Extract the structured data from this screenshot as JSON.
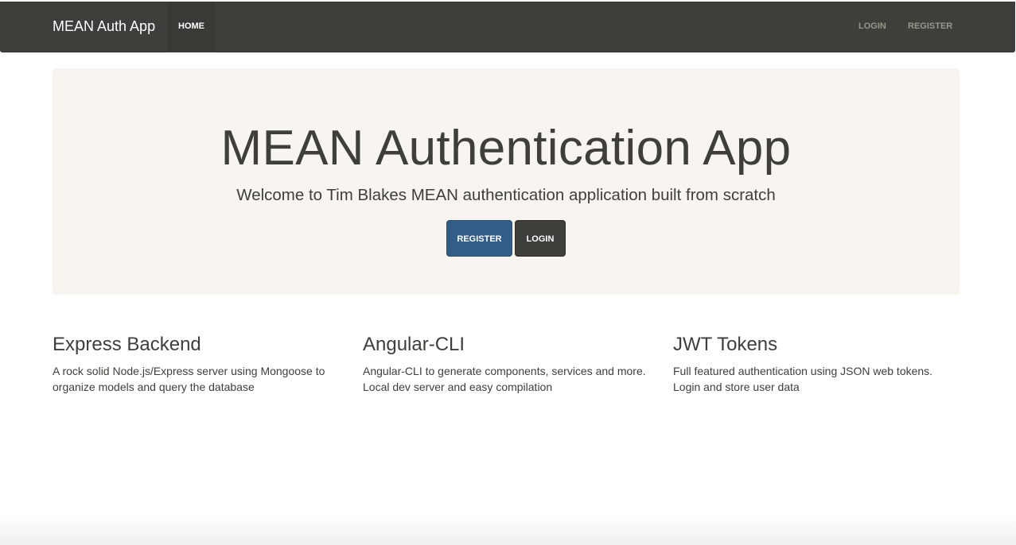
{
  "navbar": {
    "brand": "MEAN Auth App",
    "home": "HOME",
    "login": "LOGIN",
    "register": "REGISTER"
  },
  "jumbotron": {
    "title": "MEAN Authentication App",
    "lead": "Welcome to Tim Blakes MEAN authentication application built from scratch",
    "register_label": "REGISTER",
    "login_label": "LOGIN"
  },
  "features": [
    {
      "title": "Express Backend",
      "text": "A rock solid Node.js/Express server using Mongoose to organize models and query the database"
    },
    {
      "title": "Angular-CLI",
      "text": "Angular-CLI to generate components, services and more. Local dev server and easy compilation"
    },
    {
      "title": "JWT Tokens",
      "text": "Full featured authentication using JSON web tokens. Login and store user data"
    }
  ],
  "colors": {
    "navbar_bg": "#3e3f3a",
    "jumbotron_bg": "#f8f5f0",
    "primary": "#325d88",
    "text": "#3e3f3a"
  }
}
